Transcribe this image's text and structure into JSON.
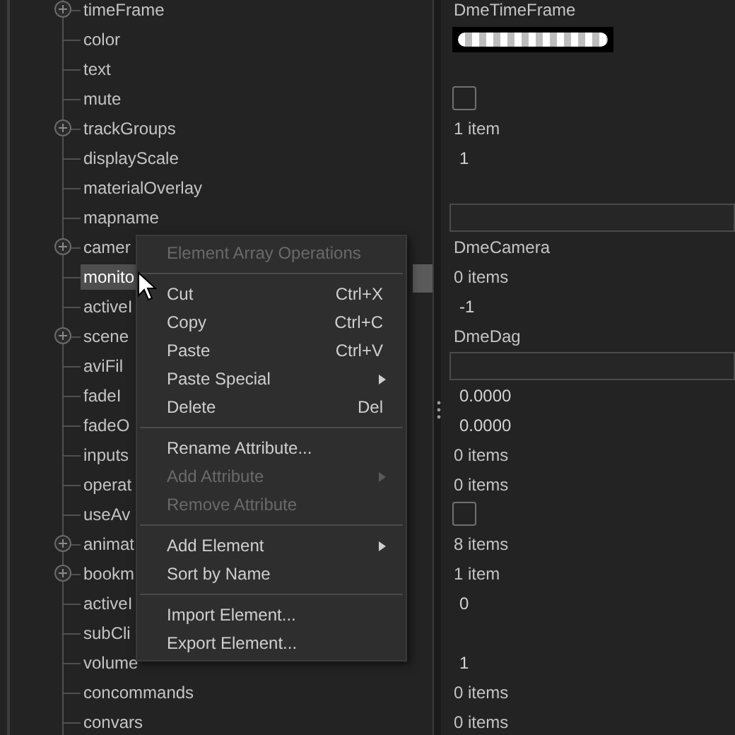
{
  "rows": [
    {
      "name": "timeFrame",
      "has_children": true,
      "selected": false,
      "value": {
        "kind": "text",
        "text": "DmeTimeFrame"
      }
    },
    {
      "name": "color",
      "has_children": false,
      "selected": false,
      "value": {
        "kind": "swatch"
      }
    },
    {
      "name": "text",
      "has_children": false,
      "selected": false,
      "value": {
        "kind": "empty"
      }
    },
    {
      "name": "mute",
      "has_children": false,
      "selected": false,
      "value": {
        "kind": "checkbox",
        "checked": false
      }
    },
    {
      "name": "trackGroups",
      "has_children": true,
      "selected": false,
      "value": {
        "kind": "text",
        "text": "1 item"
      }
    },
    {
      "name": "displayScale",
      "has_children": false,
      "selected": false,
      "value": {
        "kind": "number",
        "text": "1"
      }
    },
    {
      "name": "materialOverlay",
      "has_children": false,
      "selected": false,
      "value": {
        "kind": "empty"
      }
    },
    {
      "name": "mapname",
      "has_children": false,
      "selected": false,
      "value": {
        "kind": "field"
      }
    },
    {
      "name": "camer",
      "has_children": true,
      "selected": false,
      "value": {
        "kind": "text",
        "text": "DmeCamera"
      }
    },
    {
      "name": "monito",
      "has_children": false,
      "selected": true,
      "value": {
        "kind": "text",
        "text": "0 items"
      }
    },
    {
      "name": "activeI",
      "has_children": false,
      "selected": false,
      "value": {
        "kind": "number",
        "text": "-1"
      }
    },
    {
      "name": "scene",
      "has_children": true,
      "selected": false,
      "value": {
        "kind": "text",
        "text": "DmeDag"
      }
    },
    {
      "name": "aviFil",
      "has_children": false,
      "selected": false,
      "value": {
        "kind": "field"
      }
    },
    {
      "name": "fadeI",
      "has_children": false,
      "selected": false,
      "value": {
        "kind": "number",
        "text": "0.0000"
      }
    },
    {
      "name": "fadeO",
      "has_children": false,
      "selected": false,
      "value": {
        "kind": "number",
        "text": "0.0000"
      }
    },
    {
      "name": "inputs",
      "has_children": false,
      "selected": false,
      "value": {
        "kind": "text",
        "text": "0 items"
      }
    },
    {
      "name": "operat",
      "has_children": false,
      "selected": false,
      "value": {
        "kind": "text",
        "text": "0 items"
      }
    },
    {
      "name": "useAv",
      "has_children": false,
      "selected": false,
      "value": {
        "kind": "checkbox",
        "checked": false
      }
    },
    {
      "name": "animat",
      "has_children": true,
      "selected": false,
      "value": {
        "kind": "text",
        "text": "8 items"
      }
    },
    {
      "name": "bookm",
      "has_children": true,
      "selected": false,
      "value": {
        "kind": "text",
        "text": "1 item"
      }
    },
    {
      "name": "activeI",
      "has_children": false,
      "selected": false,
      "value": {
        "kind": "number",
        "text": "0"
      }
    },
    {
      "name": "subCli",
      "has_children": false,
      "selected": false,
      "value": {
        "kind": "empty"
      }
    },
    {
      "name": "volume",
      "has_children": false,
      "selected": false,
      "value": {
        "kind": "number",
        "text": "1"
      }
    },
    {
      "name": "concommands",
      "has_children": false,
      "selected": false,
      "value": {
        "kind": "text",
        "text": "0 items"
      }
    },
    {
      "name": "convars",
      "has_children": false,
      "selected": false,
      "value": {
        "kind": "text",
        "text": "0 items"
      }
    }
  ],
  "context_menu": [
    {
      "kind": "header",
      "label": "Element Array Operations"
    },
    {
      "kind": "separator"
    },
    {
      "kind": "item",
      "label": "Cut",
      "shortcut": "Ctrl+X",
      "disabled": false,
      "submenu": false
    },
    {
      "kind": "item",
      "label": "Copy",
      "shortcut": "Ctrl+C",
      "disabled": false,
      "submenu": false
    },
    {
      "kind": "item",
      "label": "Paste",
      "shortcut": "Ctrl+V",
      "disabled": false,
      "submenu": false
    },
    {
      "kind": "item",
      "label": "Paste Special",
      "disabled": false,
      "submenu": true
    },
    {
      "kind": "item",
      "label": "Delete",
      "shortcut": "Del",
      "disabled": false,
      "submenu": false
    },
    {
      "kind": "separator"
    },
    {
      "kind": "item",
      "label": "Rename Attribute...",
      "disabled": false,
      "submenu": false
    },
    {
      "kind": "item",
      "label": "Add Attribute",
      "disabled": true,
      "submenu": true
    },
    {
      "kind": "item",
      "label": "Remove Attribute",
      "disabled": true,
      "submenu": false
    },
    {
      "kind": "separator"
    },
    {
      "kind": "item",
      "label": "Add Element",
      "disabled": false,
      "submenu": true
    },
    {
      "kind": "item",
      "label": "Sort by Name",
      "disabled": false,
      "submenu": false
    },
    {
      "kind": "separator"
    },
    {
      "kind": "item",
      "label": "Import Element...",
      "disabled": false,
      "submenu": false
    },
    {
      "kind": "item",
      "label": "Export Element...",
      "disabled": false,
      "submenu": false
    }
  ]
}
